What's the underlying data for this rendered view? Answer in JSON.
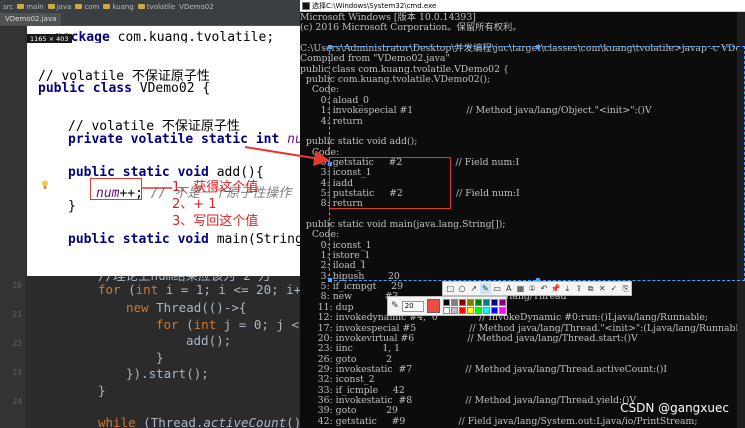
{
  "ide": {
    "breadcrumb": [
      "src",
      "main",
      "java",
      "com",
      "kuang",
      "tvolatile",
      "VDemo02"
    ],
    "tab": "VDemo02.java",
    "gutter": [
      "10",
      "11",
      "12",
      "13",
      "14",
      "15",
      "16",
      "17",
      "18",
      "19",
      "20",
      "21",
      "22",
      "23",
      "24",
      "25",
      "26"
    ],
    "dark_code": {
      "l1": "//理论上num结果应该为 2 万",
      "l2a": "for",
      "l2b": " (",
      "l2c": "int",
      "l2d": " i = 1; i <= 20; i++",
      "l3a": "new",
      "l3b": " Thread(()->{",
      "l4a": "for",
      "l4b": " (",
      "l4c": "int",
      "l4d": " j = 0; j <",
      "l5": "add();",
      "l6": "}",
      "l7": "}).start();",
      "l8": "}",
      "l9a": "while",
      "l9b": " (Thread.",
      "l9c": "activeCount",
      "l9d": "()>"
    }
  },
  "snippet": {
    "size_label": "1165 × 403",
    "pkg_kw": "package",
    "pkg": " com.kuang.tvolatile;",
    "c1": "// volatile 不保证原子性",
    "class_kw1": "public class",
    "class_name": " VDemo02 {",
    "c2": "// volatile 不保证原子性",
    "field_kw": "private volatile static int",
    "field_name": " num",
    "add_kw": "public static void",
    "add_sig": " add(){",
    "stmt_field": "num",
    "stmt_rest": "++;",
    "stmt_comment": " // 不是一个原子性操作",
    "close1": "}",
    "main_kw": "public static void",
    "main_sig": " main(String[] args) {"
  },
  "annotation": {
    "line1": "1、获得这个值",
    "line2": "2、+ 1",
    "line3": "3、写回这个值"
  },
  "cmd": {
    "title": "选择C:\\Windows\\System32\\cmd.exe",
    "lines": [
      "Microsoft Windows [版本 10.0.14393]",
      "(c) 2016 Microsoft Corporation。保留所有权利。",
      "",
      "C:\\Users\\Administrator\\Desktop\\并发编程\\juc\\target\\classes\\com\\kuang\\tvolatile>javap -c VDemo02.class",
      "Compiled from \"VDemo02.java\"",
      "public class com.kuang.tvolatile.VDemo02 {",
      "  public com.kuang.tvolatile.VDemo02();",
      "    Code:",
      "       0: aload_0",
      "       1: invokespecial #1                  // Method java/lang/Object.\"<init>\":()V",
      "       4: return",
      "",
      "  public static void add();",
      "    Code:",
      "       0: getstatic     #2                  // Field num:I",
      "       3: iconst_1",
      "       4: iadd",
      "       5: putstatic     #2                  // Field num:I",
      "       8: return",
      "",
      "  public static void main(java.lang.String[]);",
      "    Code:",
      "       0: iconst_1",
      "       1: istore_1",
      "       2: iload_1",
      "       3: bipush        20",
      "       5: if_icmpgt     29",
      "       8: new           #3                  // class java/lang/Thread",
      "      11: dup",
      "      12: invokedynamic #4,  0              // InvokeDynamic #0:run:()Ljava/lang/Runnable;",
      "      17: invokespecial #5                  // Method java/lang/Thread.\"<init>\":(Ljava/lang/Runnable;)V",
      "      20: invokevirtual #6                  // Method java/lang/Thread.start:()V",
      "      23: iinc          1, 1",
      "      26: goto          2",
      "      29: invokestatic  #7                  // Method java/lang/Thread.activeCount:()I",
      "      32: iconst_2",
      "      33: if_icmple     42",
      "      36: invokestatic  #8                  // Method java/lang/Thread.yield:()V",
      "      39: goto          29",
      "      42: getstatic     #9                  // Field java/lang/System.out:Ljava/io/PrintStream;"
    ]
  },
  "toolbar": {
    "tools": [
      "rect-tool",
      "ellipse-tool",
      "arrow-tool",
      "pen-tool",
      "marker-tool",
      "text-tool",
      "mosaic-tool",
      "number-tool",
      "undo-tool",
      "pin-tool",
      "download-tool",
      "share-tool",
      "copy-tool",
      "close-tool",
      "done-tool",
      "save-tool"
    ],
    "glyphs": [
      "□",
      "○",
      "↗",
      "✎",
      "▭",
      "A",
      "▦",
      "①",
      "↶",
      "📌",
      "⤓",
      "⇪",
      "⧉",
      "✕",
      "✓",
      "⎘"
    ],
    "size_value": "20",
    "current_color": "#ef4b45",
    "palette": [
      "#000000",
      "#808080",
      "#800000",
      "#808000",
      "#008000",
      "#008080",
      "#000080",
      "#800080",
      "#ffffff",
      "#c0c0c0",
      "#ff0000",
      "#ffff00",
      "#00ff00",
      "#00ffff",
      "#0000ff",
      "#ff00ff"
    ]
  },
  "watermark": "CSDN @gangxuec"
}
